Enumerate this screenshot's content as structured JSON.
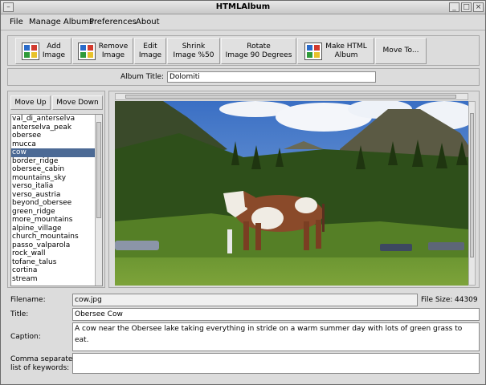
{
  "window": {
    "title": "HTMLAlbum"
  },
  "menu": [
    "File",
    "Manage Albums",
    "Preferences",
    "About"
  ],
  "toolbar": {
    "add_image": "Add\nImage",
    "remove_image": "Remove\nImage",
    "edit_image": "Edit\nImage",
    "shrink_image": "Shrink\nImage %50",
    "rotate_image": "Rotate\nImage 90 Degrees",
    "make_html": "Make HTML\nAlbum",
    "move_to": "Move To..."
  },
  "album": {
    "label": "Album Title:",
    "value": "Dolomiti"
  },
  "side": {
    "move_up": "Move Up",
    "move_down": "Move Down",
    "items": [
      "val_di_anterselva",
      "anterselva_peak",
      "obersee",
      "mucca",
      "cow",
      "border_ridge",
      "obersee_cabin",
      "mountains_sky",
      "verso_italia",
      "verso_austria",
      "beyond_obersee",
      "green_ridge",
      "more_mountains",
      "alpine_village",
      "church_mountains",
      "passo_valparola",
      "rock_wall",
      "tofane_talus",
      "cortina",
      "stream"
    ],
    "selected_index": 4
  },
  "details": {
    "filename_label": "Filename:",
    "filename": "cow.jpg",
    "filesize_label": "File Size:",
    "filesize": "44309",
    "title_label": "Title:",
    "title": "Obersee Cow",
    "caption_label": "Caption:",
    "caption": "A cow near the Obersee lake taking everything in stride on a warm summer day with lots of green grass to eat.",
    "keywords_label": "Comma separated\nlist of keywords:",
    "keywords": ""
  },
  "colors": {
    "selection": "#4c6a95",
    "window_bg": "#dcdcdc"
  }
}
